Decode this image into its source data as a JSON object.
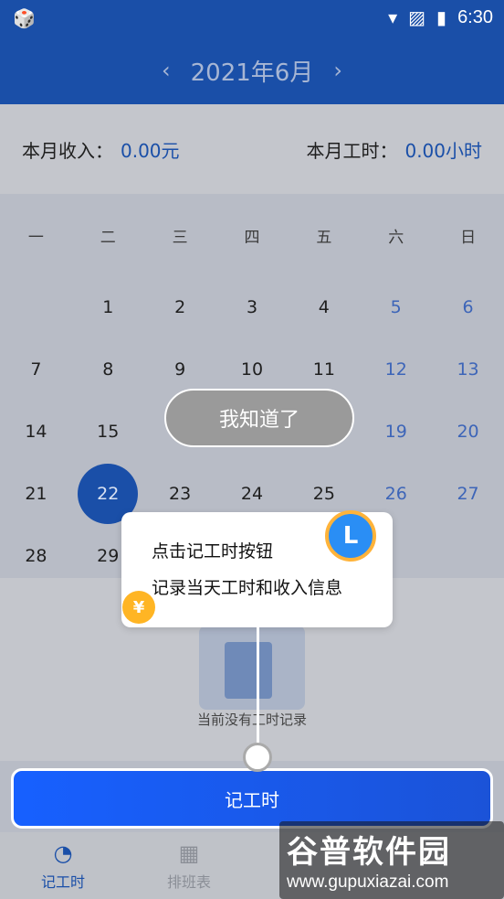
{
  "status_bar": {
    "time": "6:30"
  },
  "header": {
    "month": "2021年6月",
    "prev_icon": "chevron-left-icon",
    "next_icon": "chevron-right-icon"
  },
  "summary": {
    "income_label": "本月收入：",
    "income_value": "0.00元",
    "hours_label": "本月工时：",
    "hours_value": "0.00小时"
  },
  "weekdays": [
    "一",
    "二",
    "三",
    "四",
    "五",
    "六",
    "日"
  ],
  "days": [
    {
      "label": "",
      "weekend": false
    },
    {
      "label": "1",
      "weekend": false
    },
    {
      "label": "2",
      "weekend": false
    },
    {
      "label": "3",
      "weekend": false
    },
    {
      "label": "4",
      "weekend": false
    },
    {
      "label": "5",
      "weekend": true
    },
    {
      "label": "6",
      "weekend": true
    },
    {
      "label": "7",
      "weekend": false
    },
    {
      "label": "8",
      "weekend": false
    },
    {
      "label": "9",
      "weekend": false
    },
    {
      "label": "10",
      "weekend": false
    },
    {
      "label": "11",
      "weekend": false
    },
    {
      "label": "12",
      "weekend": true
    },
    {
      "label": "13",
      "weekend": true
    },
    {
      "label": "14",
      "weekend": false
    },
    {
      "label": "15",
      "weekend": false
    },
    {
      "label": "",
      "weekend": false
    },
    {
      "label": "",
      "weekend": false
    },
    {
      "label": "",
      "weekend": false
    },
    {
      "label": "19",
      "weekend": true
    },
    {
      "label": "20",
      "weekend": true
    },
    {
      "label": "21",
      "weekend": false
    },
    {
      "label": "22",
      "weekend": false,
      "selected": true
    },
    {
      "label": "23",
      "weekend": false
    },
    {
      "label": "24",
      "weekend": false
    },
    {
      "label": "25",
      "weekend": false
    },
    {
      "label": "26",
      "weekend": true
    },
    {
      "label": "27",
      "weekend": true
    },
    {
      "label": "28",
      "weekend": false
    },
    {
      "label": "29",
      "weekend": false
    },
    {
      "label": "",
      "weekend": false
    },
    {
      "label": "",
      "weekend": false
    },
    {
      "label": "",
      "weekend": false
    },
    {
      "label": "",
      "weekend": false
    },
    {
      "label": "",
      "weekend": false
    }
  ],
  "empty_state": {
    "text": "当前没有工时记录"
  },
  "record_button": {
    "label": "记工时"
  },
  "guide": {
    "dismiss_label": "我知道了",
    "tip_line1": "点击记工时按钮",
    "tip_line2": "记录当天工时和收入信息",
    "clock_icon": "alarm-clock-icon",
    "coin_icon": "yen-coin-icon"
  },
  "bottom_nav": [
    {
      "label": "记工时",
      "icon": "clock-refresh-icon",
      "active": true
    },
    {
      "label": "排班表",
      "icon": "calendar-icon",
      "active": false
    },
    {
      "label": "",
      "icon": "",
      "active": false
    },
    {
      "label": "",
      "icon": "",
      "active": false
    }
  ],
  "watermark": {
    "line1": "谷普软件园",
    "line2": "www.gupuxiazai.com"
  },
  "colors": {
    "header_bg": "#1a4fa8",
    "accent": "#1760ff",
    "weekend": "#3d65b8"
  }
}
